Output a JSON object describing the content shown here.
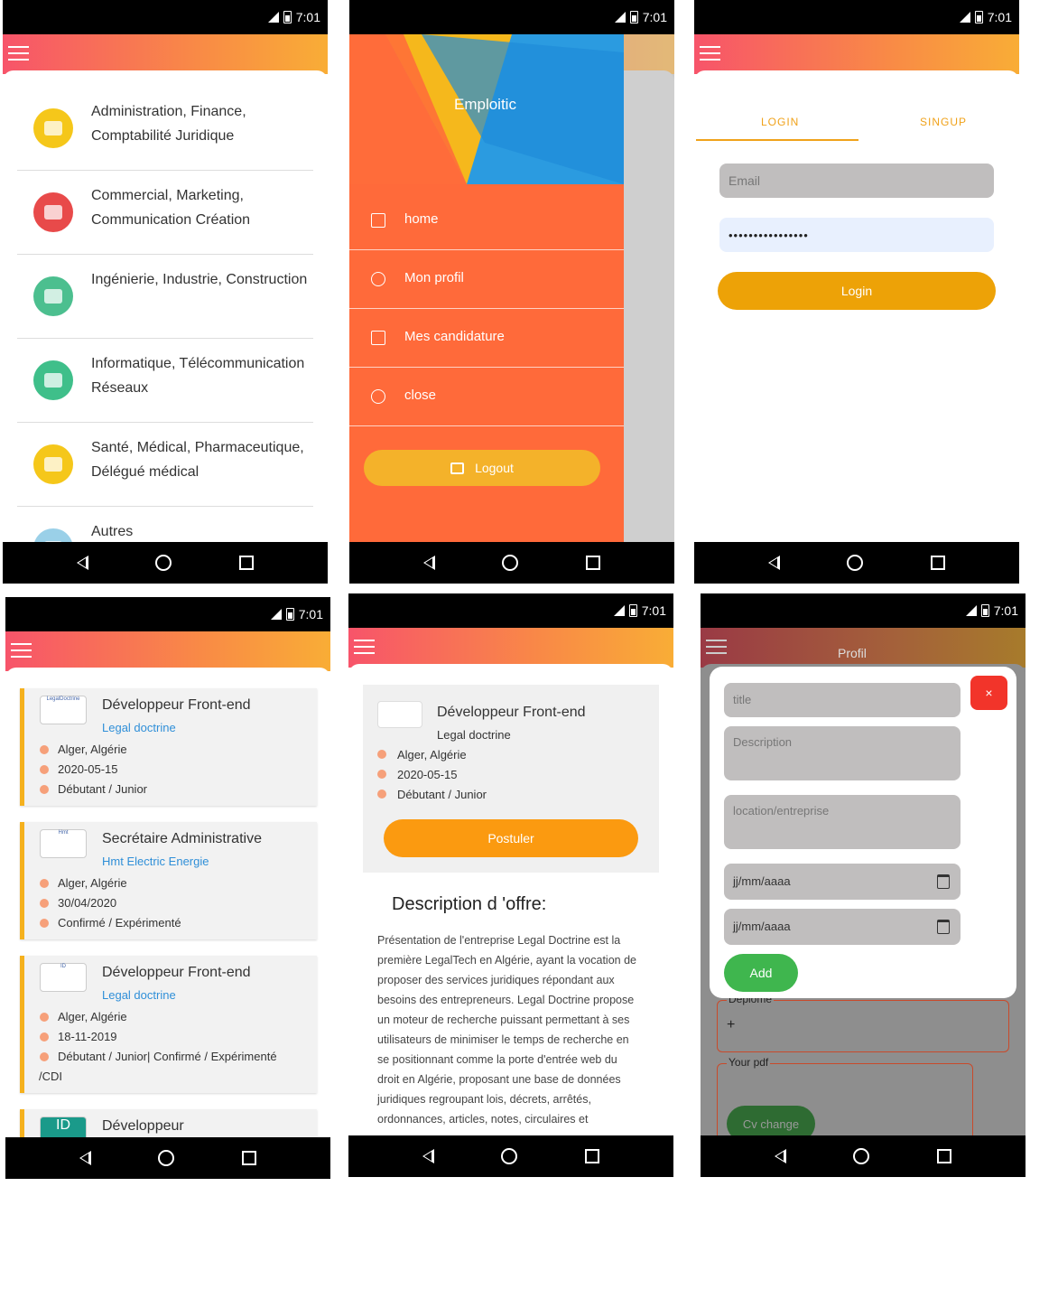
{
  "status": {
    "time": "7:01"
  },
  "screen1": {
    "categories": [
      {
        "label": "Administration, Finance, Comptabilité Juridique",
        "icon": "book-icon",
        "color": "#f5c71a"
      },
      {
        "label": "Commercial, Marketing, Communication Création",
        "icon": "factory-icon",
        "color": "#e84a4a"
      },
      {
        "label": "Ingénierie, Industrie, Construction",
        "icon": "trolley-icon",
        "color": "#4cbf8f"
      },
      {
        "label": "Informatique, Télécommunication Réseaux",
        "icon": "monitor-icon",
        "color": "#3fbf8a"
      },
      {
        "label": "Santé, Médical, Pharmaceutique, Délégué médical",
        "icon": "heart-icon",
        "color": "#f5c71a"
      },
      {
        "label": "Autres",
        "icon": "chat-icon",
        "color": "#9ad0e8"
      }
    ]
  },
  "screen2": {
    "brand": "Emploitic",
    "menu": [
      {
        "label": "home",
        "icon": "home-icon"
      },
      {
        "label": "Mon profil",
        "icon": "user-icon"
      },
      {
        "label": "Mes candidature",
        "icon": "basket-icon"
      },
      {
        "label": "close",
        "icon": "power-icon"
      }
    ],
    "logout": "Logout"
  },
  "screen3": {
    "tabs": [
      "LOGIN",
      "SINGUP"
    ],
    "email_placeholder": "Email",
    "password_value": "••••••••••••••••",
    "login_button": "Login"
  },
  "screen4": {
    "jobs": [
      {
        "title": "Développeur Front-end",
        "company": "Legal doctrine",
        "location": "Alger, Algérie",
        "date": "2020-05-15",
        "level": "Débutant / Junior",
        "logo": "LegalDoctrine"
      },
      {
        "title": "Secrétaire Administrative",
        "company": "Hmt Electric Energie",
        "location": "Alger, Algérie",
        "date": "30/04/2020",
        "level": "Confirmé / Expérimenté",
        "logo": "Hmt"
      },
      {
        "title": "Développeur Front-end",
        "company": "Legal doctrine",
        "location": "Alger, Algérie",
        "date": "18-11-2019",
        "level": "Débutant / Junior| Confirmé / Expérimenté",
        "level2": "/CDI",
        "logo": "ID"
      },
      {
        "title": "Développeur",
        "logo": "ID"
      }
    ]
  },
  "screen5": {
    "title": "Développeur Front-end",
    "company": "Legal doctrine",
    "location": "Alger, Algérie",
    "date": "2020-05-15",
    "level": "Débutant / Junior",
    "apply": "Postuler",
    "desc_heading": "Description d 'offre:",
    "desc_lines": [
      "Présentation de l'entreprise Legal Doctrine est la",
      "première LegalTech en Algérie, ayant la vocation de",
      "proposer des services juridiques répondant aux",
      "besoins des entrepreneurs. Legal Doctrine propose",
      "un moteur de recherche puissant permettant à ses",
      "utilisateurs de minimiser le temps de recherche en",
      "se positionnant comme la porte d'entrée web du",
      "droit en Algérie, proposant une base de données",
      "juridiques regroupant lois, décrets, arrêtés,",
      "ordonnances, articles, notes, circulaires et"
    ]
  },
  "screen6": {
    "appbar_title": "Profil",
    "title_ph": "title",
    "description_ph": "Description",
    "location_ph": "location/entreprise",
    "date_ph1": "jj/mm/aaaa",
    "date_ph2": "jj/mm/aaaa",
    "add": "Add",
    "close": "×",
    "diplome_label": "Deplome",
    "plus": "+",
    "pdf_label": "Your pdf",
    "cv_button": "Cv change"
  }
}
